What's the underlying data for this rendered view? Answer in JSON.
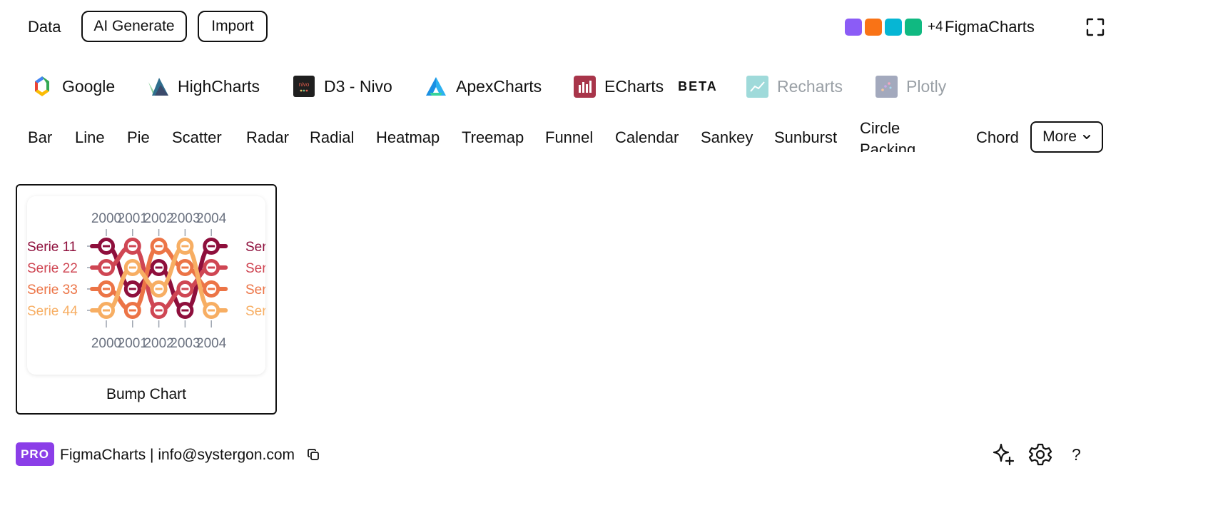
{
  "top": {
    "data_label": "Data",
    "ai_generate_label": "AI Generate",
    "import_label": "Import",
    "swatches": [
      "#8b5cf6",
      "#f97316",
      "#06b6d4",
      "#10b981"
    ],
    "swatch_more": "+4",
    "brand": "FigmaCharts",
    "icons": {
      "fullscreen": "fullscreen-icon"
    }
  },
  "libraries": [
    {
      "label": "Google",
      "icon": "google-icon",
      "dim": false
    },
    {
      "label": "HighCharts",
      "icon": "highcharts-icon",
      "dim": false
    },
    {
      "label": "D3 - Nivo",
      "icon": "nivo-icon",
      "icon_text": "nivo",
      "dim": false
    },
    {
      "label": "ApexCharts",
      "icon": "apexcharts-icon",
      "dim": false
    },
    {
      "label": "ECharts",
      "icon": "echarts-icon",
      "dim": false,
      "badge": "BETA"
    },
    {
      "label": "Recharts",
      "icon": "recharts-icon",
      "dim": true
    },
    {
      "label": "Plotly",
      "icon": "plotly-icon",
      "dim": true
    }
  ],
  "chart_types": [
    "Bar",
    "Line",
    "Pie",
    "Scatter",
    "Radar",
    "Radial",
    "Heatmap",
    "Treemap",
    "Funnel",
    "Calendar",
    "Sankey",
    "Sunburst",
    "Circle Packing",
    "Chord"
  ],
  "more_label": "More",
  "card": {
    "caption": "Bump Chart",
    "chart_data": {
      "type": "line",
      "x": [
        "2000",
        "2001",
        "2002",
        "2003",
        "2004"
      ],
      "ylim": [
        1,
        4
      ],
      "series": [
        {
          "name": "Serie 1",
          "label_visible": "Serie 11",
          "right_label": "Ser",
          "color": "#8e0f3c",
          "ranks": [
            1,
            3,
            2,
            4,
            1
          ]
        },
        {
          "name": "Serie 2",
          "label_visible": "Serie 22",
          "right_label": "Ser",
          "color": "#cf4653",
          "ranks": [
            2,
            1,
            4,
            3,
            2
          ]
        },
        {
          "name": "Serie 3",
          "label_visible": "Serie 33",
          "right_label": "Ser",
          "color": "#ec7446",
          "ranks": [
            3,
            4,
            1,
            2,
            3
          ]
        },
        {
          "name": "Serie 4",
          "label_visible": "Serie 44",
          "right_label": "Ser",
          "color": "#f7ae63",
          "ranks": [
            4,
            2,
            3,
            1,
            4
          ]
        }
      ]
    }
  },
  "footer": {
    "pro": "PRO",
    "text": "FigmaCharts | info@systergon.com",
    "icons": {
      "copy": "copy-icon",
      "sparkle": "sparkle-icon",
      "settings": "gear-icon",
      "help": "help-icon"
    },
    "help_glyph": "?"
  }
}
